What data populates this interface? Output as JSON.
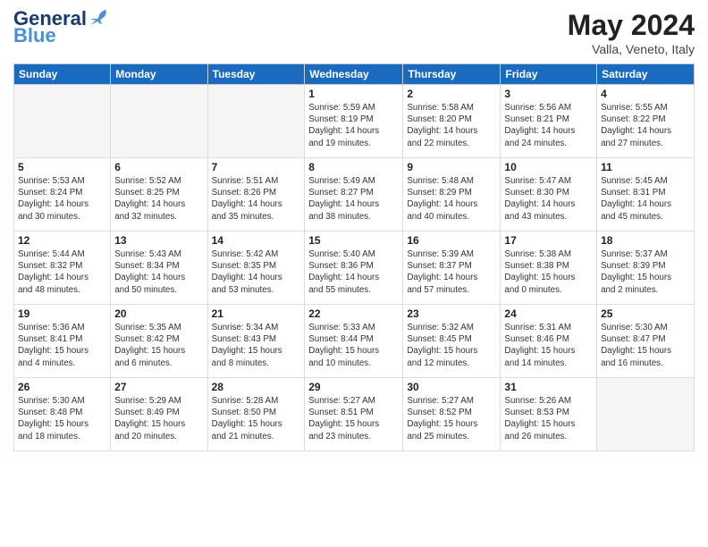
{
  "header": {
    "logo_general": "General",
    "logo_blue": "Blue",
    "month_year": "May 2024",
    "location": "Valla, Veneto, Italy"
  },
  "days_of_week": [
    "Sunday",
    "Monday",
    "Tuesday",
    "Wednesday",
    "Thursday",
    "Friday",
    "Saturday"
  ],
  "weeks": [
    [
      {
        "day": "",
        "info": ""
      },
      {
        "day": "",
        "info": ""
      },
      {
        "day": "",
        "info": ""
      },
      {
        "day": "1",
        "info": "Sunrise: 5:59 AM\nSunset: 8:19 PM\nDaylight: 14 hours\nand 19 minutes."
      },
      {
        "day": "2",
        "info": "Sunrise: 5:58 AM\nSunset: 8:20 PM\nDaylight: 14 hours\nand 22 minutes."
      },
      {
        "day": "3",
        "info": "Sunrise: 5:56 AM\nSunset: 8:21 PM\nDaylight: 14 hours\nand 24 minutes."
      },
      {
        "day": "4",
        "info": "Sunrise: 5:55 AM\nSunset: 8:22 PM\nDaylight: 14 hours\nand 27 minutes."
      }
    ],
    [
      {
        "day": "5",
        "info": "Sunrise: 5:53 AM\nSunset: 8:24 PM\nDaylight: 14 hours\nand 30 minutes."
      },
      {
        "day": "6",
        "info": "Sunrise: 5:52 AM\nSunset: 8:25 PM\nDaylight: 14 hours\nand 32 minutes."
      },
      {
        "day": "7",
        "info": "Sunrise: 5:51 AM\nSunset: 8:26 PM\nDaylight: 14 hours\nand 35 minutes."
      },
      {
        "day": "8",
        "info": "Sunrise: 5:49 AM\nSunset: 8:27 PM\nDaylight: 14 hours\nand 38 minutes."
      },
      {
        "day": "9",
        "info": "Sunrise: 5:48 AM\nSunset: 8:29 PM\nDaylight: 14 hours\nand 40 minutes."
      },
      {
        "day": "10",
        "info": "Sunrise: 5:47 AM\nSunset: 8:30 PM\nDaylight: 14 hours\nand 43 minutes."
      },
      {
        "day": "11",
        "info": "Sunrise: 5:45 AM\nSunset: 8:31 PM\nDaylight: 14 hours\nand 45 minutes."
      }
    ],
    [
      {
        "day": "12",
        "info": "Sunrise: 5:44 AM\nSunset: 8:32 PM\nDaylight: 14 hours\nand 48 minutes."
      },
      {
        "day": "13",
        "info": "Sunrise: 5:43 AM\nSunset: 8:34 PM\nDaylight: 14 hours\nand 50 minutes."
      },
      {
        "day": "14",
        "info": "Sunrise: 5:42 AM\nSunset: 8:35 PM\nDaylight: 14 hours\nand 53 minutes."
      },
      {
        "day": "15",
        "info": "Sunrise: 5:40 AM\nSunset: 8:36 PM\nDaylight: 14 hours\nand 55 minutes."
      },
      {
        "day": "16",
        "info": "Sunrise: 5:39 AM\nSunset: 8:37 PM\nDaylight: 14 hours\nand 57 minutes."
      },
      {
        "day": "17",
        "info": "Sunrise: 5:38 AM\nSunset: 8:38 PM\nDaylight: 15 hours\nand 0 minutes."
      },
      {
        "day": "18",
        "info": "Sunrise: 5:37 AM\nSunset: 8:39 PM\nDaylight: 15 hours\nand 2 minutes."
      }
    ],
    [
      {
        "day": "19",
        "info": "Sunrise: 5:36 AM\nSunset: 8:41 PM\nDaylight: 15 hours\nand 4 minutes."
      },
      {
        "day": "20",
        "info": "Sunrise: 5:35 AM\nSunset: 8:42 PM\nDaylight: 15 hours\nand 6 minutes."
      },
      {
        "day": "21",
        "info": "Sunrise: 5:34 AM\nSunset: 8:43 PM\nDaylight: 15 hours\nand 8 minutes."
      },
      {
        "day": "22",
        "info": "Sunrise: 5:33 AM\nSunset: 8:44 PM\nDaylight: 15 hours\nand 10 minutes."
      },
      {
        "day": "23",
        "info": "Sunrise: 5:32 AM\nSunset: 8:45 PM\nDaylight: 15 hours\nand 12 minutes."
      },
      {
        "day": "24",
        "info": "Sunrise: 5:31 AM\nSunset: 8:46 PM\nDaylight: 15 hours\nand 14 minutes."
      },
      {
        "day": "25",
        "info": "Sunrise: 5:30 AM\nSunset: 8:47 PM\nDaylight: 15 hours\nand 16 minutes."
      }
    ],
    [
      {
        "day": "26",
        "info": "Sunrise: 5:30 AM\nSunset: 8:48 PM\nDaylight: 15 hours\nand 18 minutes."
      },
      {
        "day": "27",
        "info": "Sunrise: 5:29 AM\nSunset: 8:49 PM\nDaylight: 15 hours\nand 20 minutes."
      },
      {
        "day": "28",
        "info": "Sunrise: 5:28 AM\nSunset: 8:50 PM\nDaylight: 15 hours\nand 21 minutes."
      },
      {
        "day": "29",
        "info": "Sunrise: 5:27 AM\nSunset: 8:51 PM\nDaylight: 15 hours\nand 23 minutes."
      },
      {
        "day": "30",
        "info": "Sunrise: 5:27 AM\nSunset: 8:52 PM\nDaylight: 15 hours\nand 25 minutes."
      },
      {
        "day": "31",
        "info": "Sunrise: 5:26 AM\nSunset: 8:53 PM\nDaylight: 15 hours\nand 26 minutes."
      },
      {
        "day": "",
        "info": ""
      }
    ]
  ]
}
